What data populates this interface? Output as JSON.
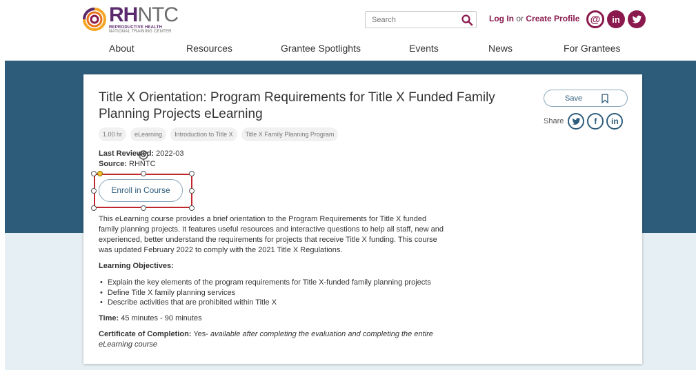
{
  "header": {
    "logo": {
      "main_bold": "RH",
      "main_light": "NTC",
      "sub1": "REPRODUCTIVE HEALTH",
      "sub2": "NATIONAL TRAINING CENTER"
    },
    "search": {
      "placeholder": "Search"
    },
    "auth": {
      "login": "Log In",
      "or": "or",
      "create": "Create Profile"
    },
    "social": [
      {
        "icon": "at-icon",
        "glyph": "@"
      },
      {
        "icon": "linkedin-icon",
        "glyph": "in"
      },
      {
        "icon": "twitter-icon",
        "glyph": ""
      }
    ]
  },
  "nav": [
    "About",
    "Resources",
    "Grantee Spotlights",
    "Events",
    "News",
    "For Grantees"
  ],
  "course": {
    "title": "Title X Orientation: Program Requirements for Title X Funded Family Planning Projects eLearning",
    "tags": [
      "1.00 hr",
      "eLearning",
      "Introduction to Title X",
      "Title X Family Planning Program"
    ],
    "last_reviewed_label": "Last Reviewed:",
    "last_reviewed_value": "2022-03",
    "source_label": "Source:",
    "source_value": "RHNTC",
    "enroll_label": "Enroll in Course",
    "description": "This eLearning course provides a brief orientation to the Program Requirements for Title X funded family planning projects. It features useful resources and interactive questions to help all staff, new and experienced, better understand the requirements for projects that receive Title X funding. This course was updated February 2022 to comply with the 2021 Title X Regulations.",
    "objectives_heading": "Learning Objectives:",
    "objectives": [
      "Explain the key elements of the program requirements for Title X-funded family planning projects",
      "Define Title X family planning services",
      "Describe activities that are prohibited within Title X"
    ],
    "time_label": "Time:",
    "time_value": "45 minutes - 90 minutes",
    "cert_label": "Certificate of Completion:",
    "cert_value": "Yes-",
    "cert_note": "available after completing the evaluation and completing the entire eLearning course",
    "save_label": "Save",
    "share_label": "Share",
    "share_icons": [
      {
        "icon": "twitter-icon",
        "glyph": ""
      },
      {
        "icon": "facebook-icon",
        "glyph": "f"
      },
      {
        "icon": "linkedin-icon",
        "glyph": "in"
      }
    ]
  },
  "colors": {
    "brand": "#8a1a4d",
    "band": "#2d5c7b",
    "light_band": "#e6f0f4",
    "selection": "#c0272d"
  }
}
